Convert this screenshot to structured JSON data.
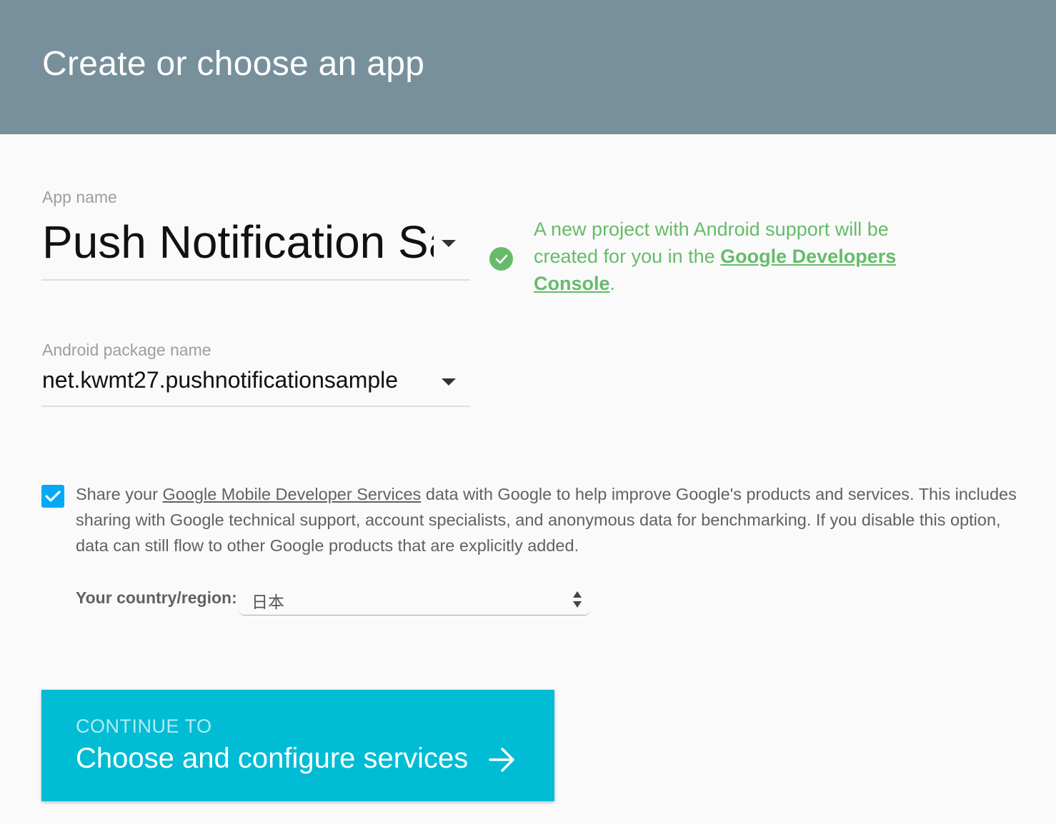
{
  "header": {
    "title": "Create or choose an app"
  },
  "app_name": {
    "label": "App name",
    "value": "Push Notification Sample"
  },
  "package_name": {
    "label": "Android package name",
    "value": "net.kwmt27.pushnotificationsample"
  },
  "notice": {
    "text_before": "A new project with Android support will be created for you in the ",
    "link": "Google Developers Console",
    "text_after": "."
  },
  "share": {
    "checked": true,
    "text_before": "Share your ",
    "link": "Google Mobile Developer Services",
    "text_after": " data with Google to help improve Google's products and services. This includes sharing with Google technical support, account specialists, and anonymous data for benchmarking. If you disable this option, data can still flow to other Google products that are explicitly added."
  },
  "country": {
    "label": "Your country/region:",
    "value": "日本"
  },
  "continue_button": {
    "kicker": "CONTINUE TO",
    "label": "Choose and configure services"
  },
  "colors": {
    "header_bg": "#78909c",
    "success_green": "#66bb6a",
    "checkbox_blue": "#03a9f4",
    "button_cyan": "#00bcd4"
  },
  "icons": [
    "check-circle-icon",
    "checkbox-check-icon",
    "dropdown-caret-icon",
    "select-updown-icon",
    "arrow-right-icon"
  ]
}
